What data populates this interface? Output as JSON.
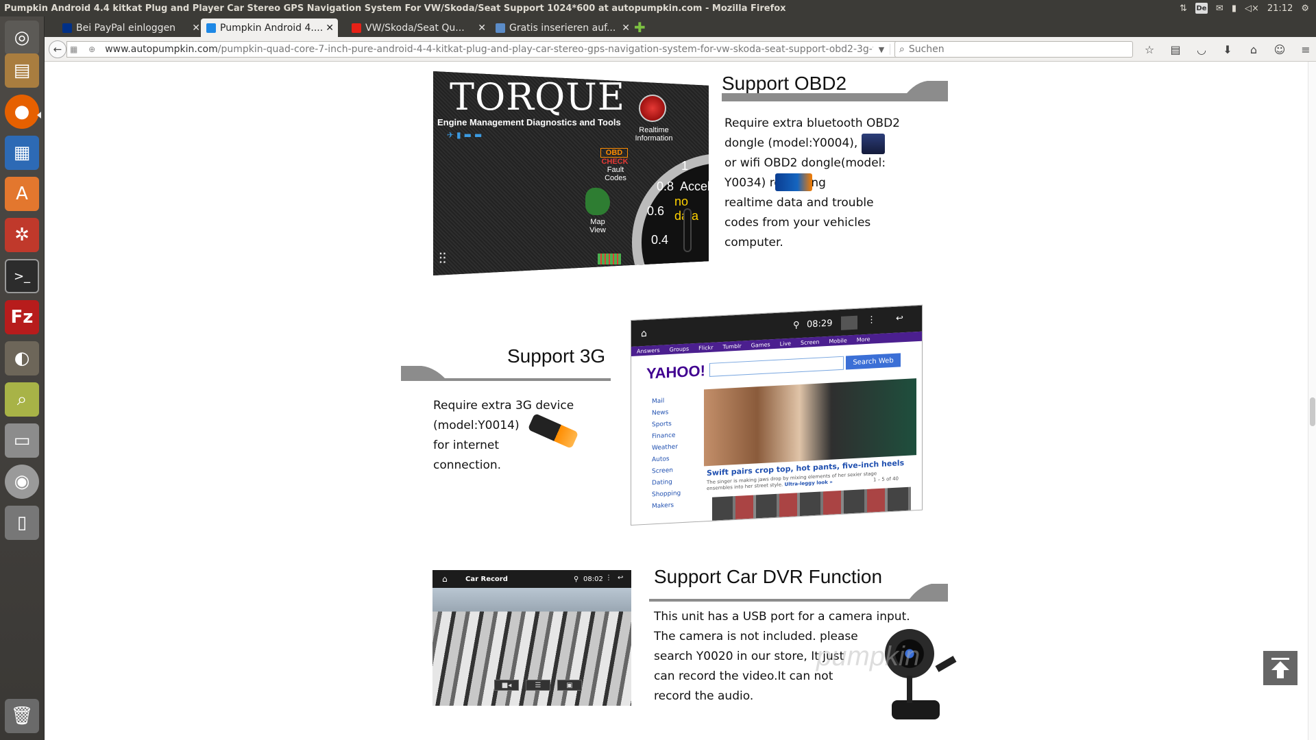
{
  "topbar": {
    "title": "Pumpkin Android 4.4 kitkat Plug and Player Car Stereo GPS Navigation System For VW/Skoda/Seat Support 1024*600 at autopumpkin.com - Mozilla Firefox",
    "keyboard_layout": "De",
    "clock": "21:12"
  },
  "launcher": {
    "items": [
      "dash-home",
      "files",
      "firefox",
      "writer",
      "software-center",
      "system-settings",
      "terminal",
      "filezilla",
      "gimp",
      "image-viewer",
      "disks",
      "dvd-drive",
      "ipod-device",
      "trash"
    ]
  },
  "tabs": [
    {
      "label": "Bei PayPal einloggen",
      "active": false
    },
    {
      "label": "Pumpkin Android 4....",
      "active": true
    },
    {
      "label": "VW/Skoda/Seat Qu...",
      "active": false
    },
    {
      "label": "Gratis inserieren auf...",
      "active": false
    }
  ],
  "navbar": {
    "url_domain": "www.autopumpkin.com",
    "url_path": "/pumpkin-quad-core-7-inch-pure-android-4-4-kitkat-plug-and-play-car-stereo-gps-navigation-system-for-vw-skoda-seat-support-obd2-3g-wi",
    "search_placeholder": "Suchen"
  },
  "sections": {
    "obd2": {
      "title": "Support OBD2",
      "lines": [
        "Require extra bluetooth OBD2",
        "dongle (model:Y0004),",
        "or wifi OBD2 dongle(model:",
        "Y0034)",
        "retrieving",
        "realtime data and trouble",
        "codes from your vehicles",
        "computer."
      ],
      "screenshot": {
        "title": "TORQUE",
        "subtitle": "Engine Management Diagnostics and Tools",
        "realtime_label": "Realtime Information",
        "fault_label": "Fault Codes",
        "map_label": "Map View",
        "obd_badge": "OBD",
        "check_label": "CHECK",
        "gauge_label": "Accel",
        "gauge_value": "no data",
        "ticks": [
          "1",
          "0.8",
          "0.6",
          "0.4"
        ]
      }
    },
    "g3": {
      "title": "Support 3G",
      "lines": [
        "Require extra 3G device",
        "(model:Y0014)",
        "for internet",
        "connection."
      ],
      "screenshot": {
        "time": "08:29",
        "nav_items": [
          "Answers",
          "Groups",
          "Flickr",
          "Tumblr",
          "Games",
          "Live",
          "Screen",
          "Mobile",
          "More"
        ],
        "logo": "YAHOO!",
        "search_button": "Search Web",
        "side_items": [
          "Mail",
          "News",
          "Sports",
          "Finance",
          "Weather",
          "Autos",
          "Screen",
          "Dating",
          "Shopping",
          "Makers"
        ],
        "headline": "Swift pairs crop top, hot pants, five-inch heels",
        "subline": "The singer is making jaws drop by mixing elements of her sexier stage ensembles into her street style.",
        "subline_link": "Ultra-leggy look »",
        "pager": "1 – 5 of 40"
      }
    },
    "dvr": {
      "title": "Support Car DVR Function",
      "lines": [
        "This unit has a USB port for a camera input.",
        "The camera is not included. please",
        "search Y0020 in our store, It just",
        "can record the video.It can not",
        "record the audio."
      ],
      "screenshot": {
        "title": "Car Record",
        "time": "08:02"
      },
      "watermark": "pumpkin"
    }
  },
  "colors": {
    "swoosh": "#8c8c8c",
    "launcher_bg": "#3c3b37",
    "firefox_green": "#7dc242"
  }
}
